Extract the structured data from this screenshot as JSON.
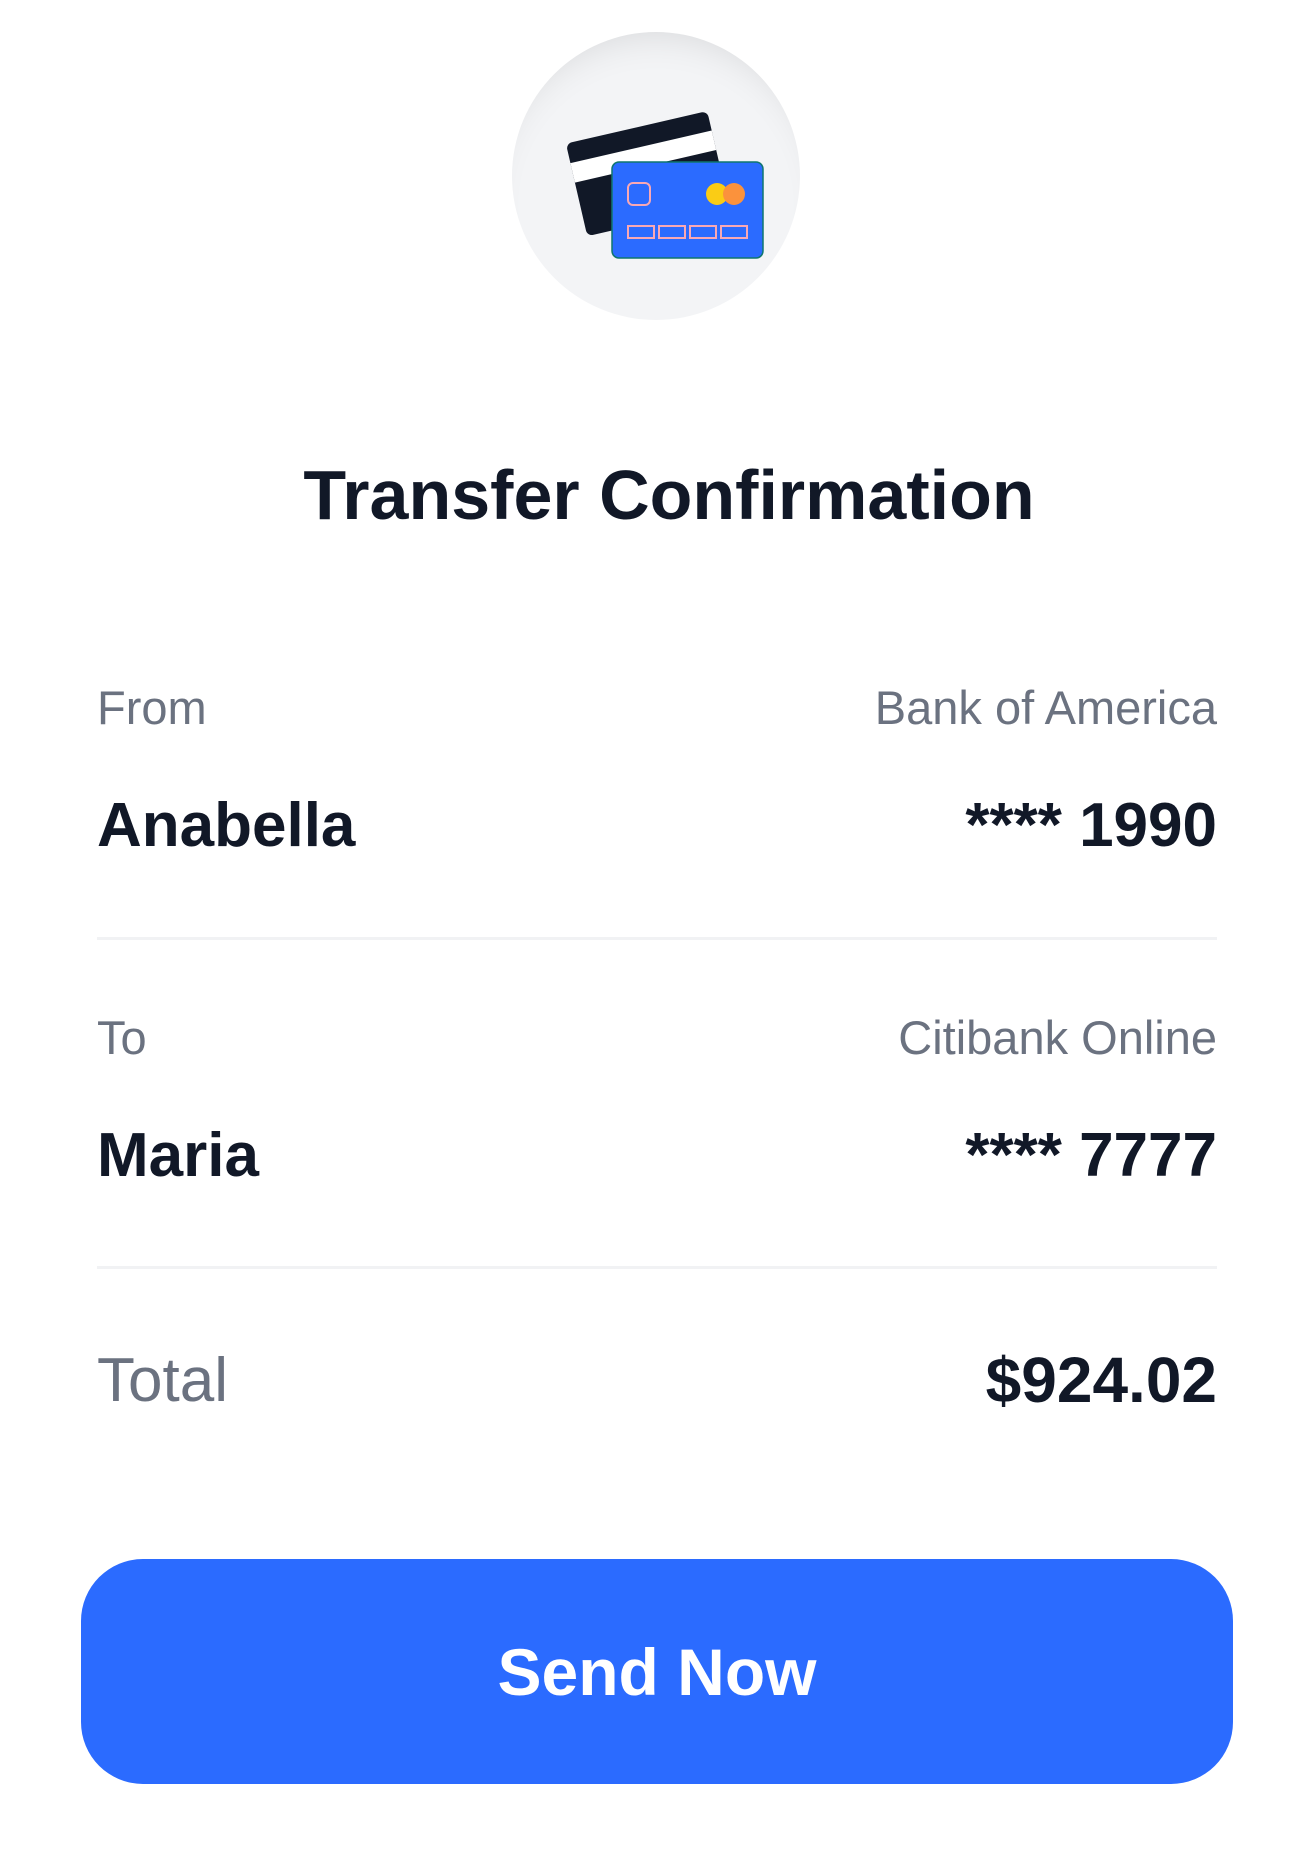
{
  "icon": {
    "name": "credit-card-icon",
    "colors": {
      "card_front": "#2b6bff",
      "card_back": "#111827",
      "dot_left": "#facc15",
      "dot_right": "#fb923c"
    }
  },
  "title": "Transfer Confirmation",
  "from": {
    "label": "From",
    "bank": "Bank of America",
    "name": "Anabella",
    "account": "**** 1990"
  },
  "to": {
    "label": "To",
    "bank": "Citibank Online",
    "name": "Maria",
    "account": "**** 7777"
  },
  "total": {
    "label": "Total",
    "amount": "$924.02"
  },
  "button": {
    "label": "Send Now",
    "color": "#2b6bff"
  }
}
